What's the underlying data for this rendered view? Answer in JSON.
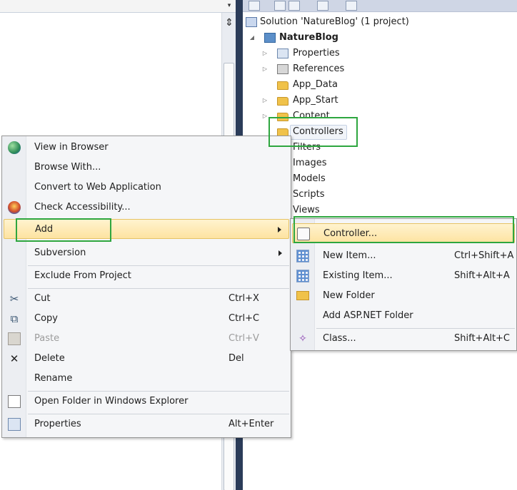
{
  "editor": {
    "dropdown_glyph": "▾",
    "split_glyph": "⇕"
  },
  "solution_explorer": {
    "solution": "Solution 'NatureBlog' (1 project)",
    "project": "NatureBlog",
    "nodes": {
      "properties": "Properties",
      "references": "References",
      "app_data": "App_Data",
      "app_start": "App_Start",
      "content": "Content",
      "controllers": "Controllers",
      "filters": "Filters",
      "images": "Images",
      "models": "Models",
      "scripts": "Scripts",
      "views": "Views"
    },
    "arrows": {
      "expanded": "◢",
      "collapsed": "▷"
    }
  },
  "context_menu": {
    "view_in_browser": "View in Browser",
    "browse_with": "Browse With...",
    "convert": "Convert to Web Application",
    "check_accessibility": "Check Accessibility...",
    "add": "Add",
    "subversion": "Subversion",
    "exclude": "Exclude From Project",
    "cut": "Cut",
    "cut_shortcut": "Ctrl+X",
    "copy": "Copy",
    "copy_shortcut": "Ctrl+C",
    "paste": "Paste",
    "paste_shortcut": "Ctrl+V",
    "delete": "Delete",
    "delete_shortcut": "Del",
    "rename": "Rename",
    "open_folder": "Open Folder in Windows Explorer",
    "properties": "Properties",
    "properties_shortcut": "Alt+Enter"
  },
  "add_submenu": {
    "controller": "Controller...",
    "new_item": "New Item...",
    "new_item_shortcut": "Ctrl+Shift+A",
    "existing_item": "Existing Item...",
    "existing_item_shortcut": "Shift+Alt+A",
    "new_folder": "New Folder",
    "add_aspnet_folder": "Add ASP.NET Folder",
    "class": "Class...",
    "class_shortcut": "Shift+Alt+C"
  },
  "icons": {
    "cut": "✂",
    "copy": "⧉",
    "delete": "✕",
    "class": "✧"
  },
  "colors": {
    "highlight": "#fde3a1",
    "annotation": "#2ea63f",
    "splitter": "#2b3c59"
  }
}
